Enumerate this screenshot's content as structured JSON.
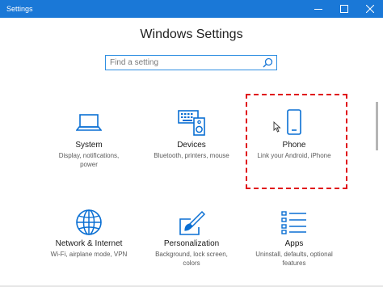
{
  "window": {
    "title": "Settings",
    "controls": [
      "minimize",
      "maximize",
      "close"
    ]
  },
  "page": {
    "title": "Windows Settings"
  },
  "search": {
    "placeholder": "Find a setting",
    "value": ""
  },
  "tiles": [
    {
      "name": "System",
      "description": "Display, notifications, power",
      "icon": "laptop-icon"
    },
    {
      "name": "Devices",
      "description": "Bluetooth, printers, mouse",
      "icon": "keyboard-speaker-icon"
    },
    {
      "name": "Phone",
      "description": "Link your Android, iPhone",
      "icon": "phone-icon",
      "highlighted": true
    },
    {
      "name": "Network & Internet",
      "description": "Wi-Fi, airplane mode, VPN",
      "icon": "globe-icon"
    },
    {
      "name": "Personalization",
      "description": "Background, lock screen, colors",
      "icon": "paint-brush-icon"
    },
    {
      "name": "Apps",
      "description": "Uninstall, defaults, optional features",
      "icon": "list-icon"
    }
  ],
  "colors": {
    "accent": "#1a78d7",
    "icon": "#0a6fd3",
    "highlight_border": "#e0131b"
  }
}
